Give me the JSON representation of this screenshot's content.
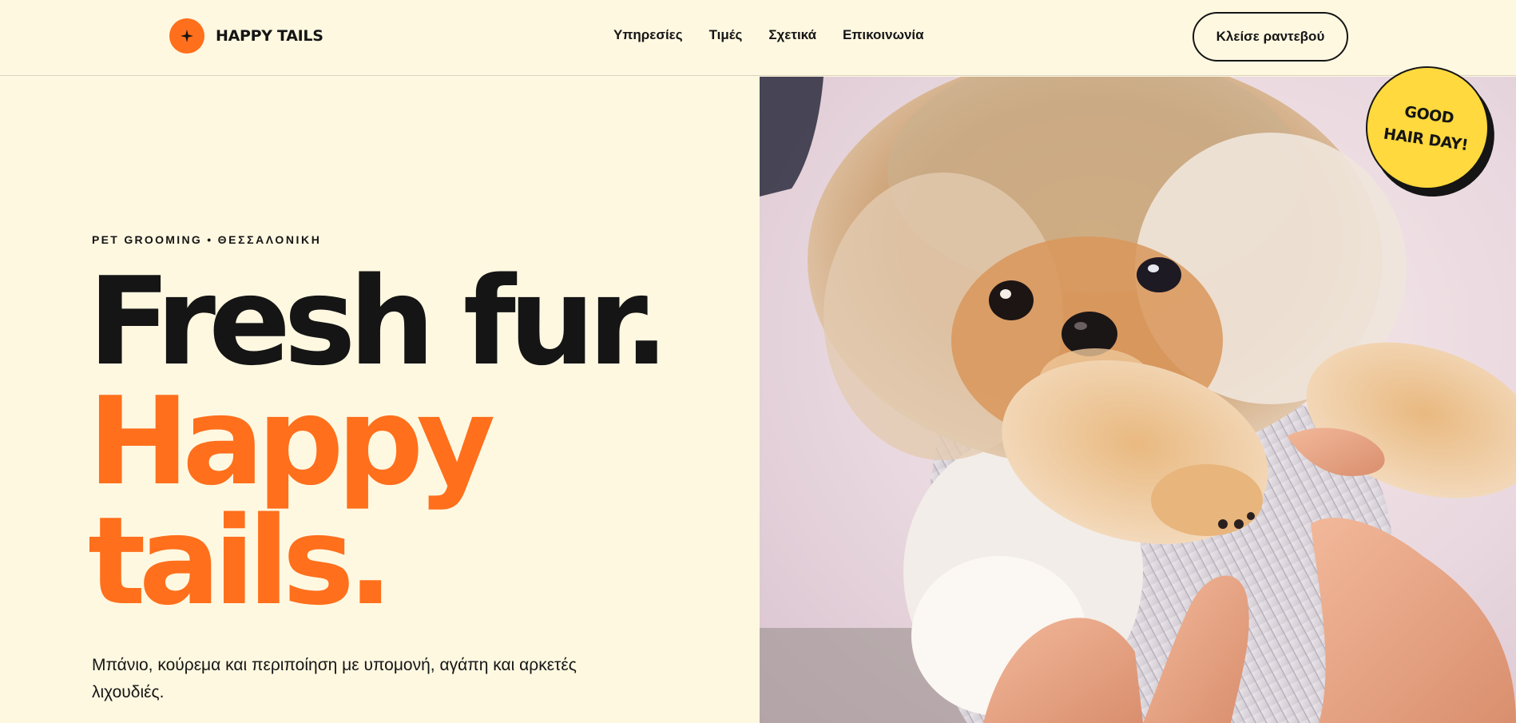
{
  "brand": {
    "name": "HAPPY TAILS",
    "mark_icon": "sparkle-icon",
    "accent_color": "#ff6f1c"
  },
  "nav": {
    "items": [
      {
        "label": "Υπηρεσίες"
      },
      {
        "label": "Τιμές"
      },
      {
        "label": "Σχετικά"
      },
      {
        "label": "Επικοινωνία"
      }
    ]
  },
  "cta": {
    "label": "Κλείσε ραντεβού"
  },
  "hero": {
    "eyebrow_prefix": "PET GROOMING •",
    "eyebrow_city": "ΘΕΣΣΑΛΟΝΙΚΗ",
    "headline_line1": "Fresh fur.",
    "headline_line2": "Happy",
    "headline_line3": "tails.",
    "lede": "Μπάνιο, κούρεμα και περιποίηση με υπομονή, αγάπη και αρκετές λιχουδιές.",
    "image_subject": "pomeranian-puppy-photo"
  },
  "sticker": {
    "line1": "GOOD",
    "line2": "HAIR DAY!",
    "color": "#ffd93d"
  }
}
